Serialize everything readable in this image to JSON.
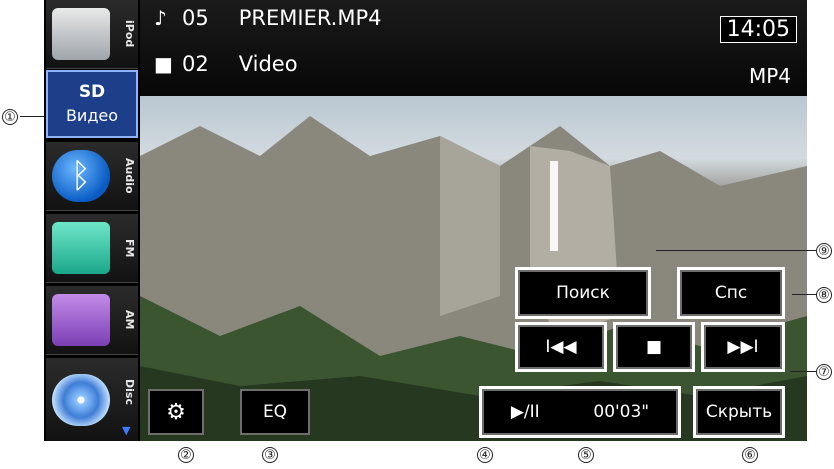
{
  "sources": [
    {
      "label": "iPod",
      "icon": "ipod-dock-icon"
    },
    {
      "label_top": "SD",
      "label_bottom": "Видео",
      "active": true
    },
    {
      "label": "Audio",
      "icon": "bluetooth-icon"
    },
    {
      "label": "FM",
      "icon": "fm-radio-icon"
    },
    {
      "label": "AM",
      "icon": "am-radio-icon"
    },
    {
      "label": "Disc",
      "icon": "disc-icon"
    }
  ],
  "header": {
    "track_number": "05",
    "track_title": "PREMIER.MP4",
    "folder_number": "02",
    "folder_name": "Video",
    "time": "14:05",
    "format": "MP4"
  },
  "controls": {
    "settings_icon": "gear-icon",
    "eq_label": "EQ",
    "search_label": "Поиск",
    "list_label": "Спс",
    "prev_glyph": "I◀◀",
    "stop_glyph": "■",
    "next_glyph": "▶▶I",
    "playpause_glyph": "▶/II",
    "elapsed": "00'03\"",
    "hide_label": "Скрыть"
  },
  "callouts": [
    "①",
    "②",
    "③",
    "④",
    "⑤",
    "⑥",
    "⑦",
    "⑧",
    "⑨"
  ]
}
